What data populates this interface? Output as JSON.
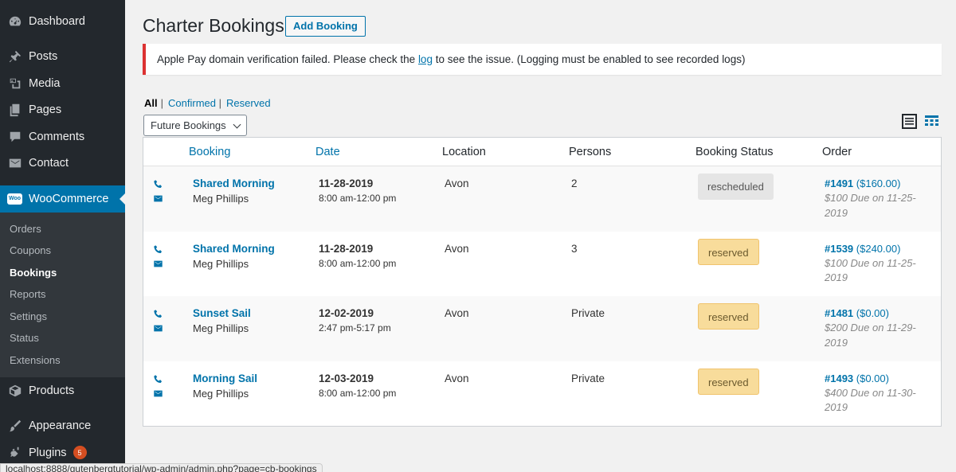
{
  "sidebar": {
    "items_top": [
      {
        "label": "Dashboard",
        "icon": "dashboard-icon"
      },
      {
        "label": "Posts",
        "icon": "pin-icon"
      },
      {
        "label": "Media",
        "icon": "media-icon"
      },
      {
        "label": "Pages",
        "icon": "pages-icon"
      },
      {
        "label": "Comments",
        "icon": "comment-icon"
      },
      {
        "label": "Contact",
        "icon": "envelope-icon"
      }
    ],
    "woocommerce": {
      "label": "WooCommerce",
      "badge": "Woo"
    },
    "submenu": [
      "Orders",
      "Coupons",
      "Bookings",
      "Reports",
      "Settings",
      "Status",
      "Extensions"
    ],
    "items_bottom": [
      {
        "label": "Products",
        "icon": "box-icon"
      },
      {
        "label": "Appearance",
        "icon": "brush-icon"
      },
      {
        "label": "Plugins",
        "icon": "plug-icon",
        "count": "5"
      }
    ]
  },
  "header": {
    "title": "Charter Bookings",
    "add_label": "Add Booking"
  },
  "notice": {
    "text_before": "Apple Pay domain verification failed. Please check the ",
    "link": "log",
    "text_after": " to see the issue. (Logging must be enabled to see recorded logs)"
  },
  "filters": {
    "all": "All",
    "confirmed": "Confirmed",
    "reserved": "Reserved"
  },
  "select": {
    "value": "Future Bookings"
  },
  "table": {
    "columns": {
      "booking": "Booking",
      "date": "Date",
      "location": "Location",
      "persons": "Persons",
      "status": "Booking Status",
      "order": "Order"
    },
    "rows": [
      {
        "title": "Shared Morning",
        "name": "Meg Phillips",
        "date": "11-28-2019",
        "time": "8:00 am-12:00 pm",
        "location": "Avon",
        "persons": "2",
        "status": "rescheduled",
        "order_num": "#1491",
        "order_total": "($160.00)",
        "due": "$100 Due on 11-25-2019"
      },
      {
        "title": "Shared Morning",
        "name": "Meg Phillips",
        "date": "11-28-2019",
        "time": "8:00 am-12:00 pm",
        "location": "Avon",
        "persons": "3",
        "status": "reserved",
        "order_num": "#1539",
        "order_total": "($240.00)",
        "due": "$100 Due on 11-25-2019"
      },
      {
        "title": "Sunset Sail",
        "name": "Meg Phillips",
        "date": "12-02-2019",
        "time": "2:47 pm-5:17 pm",
        "location": "Avon",
        "persons": "Private",
        "status": "reserved",
        "order_num": "#1481",
        "order_total": "($0.00)",
        "due": "$200 Due on 11-29-2019"
      },
      {
        "title": "Morning Sail",
        "name": "Meg Phillips",
        "date": "12-03-2019",
        "time": "8:00 am-12:00 pm",
        "location": "Avon",
        "persons": "Private",
        "status": "reserved",
        "order_num": "#1493",
        "order_total": "($0.00)",
        "due": "$400 Due on 11-30-2019"
      }
    ]
  },
  "statusbar": {
    "url": "localhost:8888/gutenbergtutorial/wp-admin/admin.php?page=cb-bookings"
  },
  "colors": {
    "accent": "#0073aa",
    "sidebar": "#23282d",
    "reserved_bg": "#f8dc9b",
    "rescheduled_bg": "#e5e5e5",
    "error": "#dc3232"
  }
}
